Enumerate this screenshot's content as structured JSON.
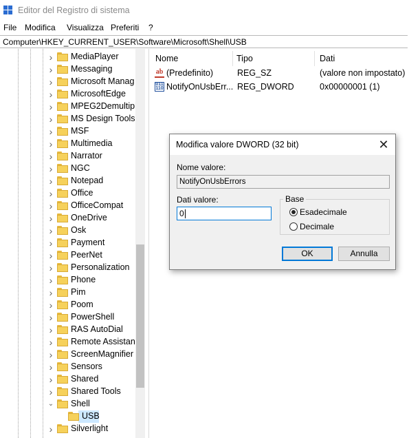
{
  "window": {
    "title": "Editor del Registro di sistema"
  },
  "menu": [
    "File",
    "Modifica",
    "Visualizza",
    "Preferiti",
    "?"
  ],
  "address": "Computer\\HKEY_CURRENT_USER\\Software\\Microsoft\\Shell\\USB",
  "tree": {
    "items": [
      "MediaPlayer",
      "Messaging",
      "Microsoft Manag",
      "MicrosoftEdge",
      "MPEG2Demultipl",
      "MS Design Tools",
      "MSF",
      "Multimedia",
      "Narrator",
      "NGC",
      "Notepad",
      "Office",
      "OfficeCompat",
      "OneDrive",
      "Osk",
      "Payment",
      "PeerNet",
      "Personalization",
      "Phone",
      "Pim",
      "Poom",
      "PowerShell",
      "RAS AutoDial",
      "Remote Assistanc",
      "ScreenMagnifier",
      "Sensors",
      "Shared",
      "Shared Tools",
      "Shell"
    ],
    "child": "USB",
    "after": "Silverlight"
  },
  "list": {
    "columns": [
      "Nome",
      "Tipo",
      "Dati"
    ],
    "rows": [
      {
        "icon": "string-value-icon",
        "name": "(Predefinito)",
        "type": "REG_SZ",
        "data": "(valore non impostato)"
      },
      {
        "icon": "dword-value-icon",
        "name": "NotifyOnUsbErr...",
        "type": "REG_DWORD",
        "data": "0x00000001 (1)"
      }
    ]
  },
  "dialog": {
    "title": "Modifica valore DWORD (32 bit)",
    "close": "✕",
    "name_label": "Nome valore:",
    "name_value": "NotifyOnUsbErrors",
    "data_label": "Dati valore:",
    "data_value": "0",
    "base_label": "Base",
    "radio_hex": "Esadecimale",
    "radio_dec": "Decimale",
    "base_selected": "Esadecimale",
    "ok": "OK",
    "cancel": "Annulla"
  },
  "colors": {
    "accent": "#0078d7",
    "folder": "#f6d15b",
    "selection": "#cce8ff"
  }
}
